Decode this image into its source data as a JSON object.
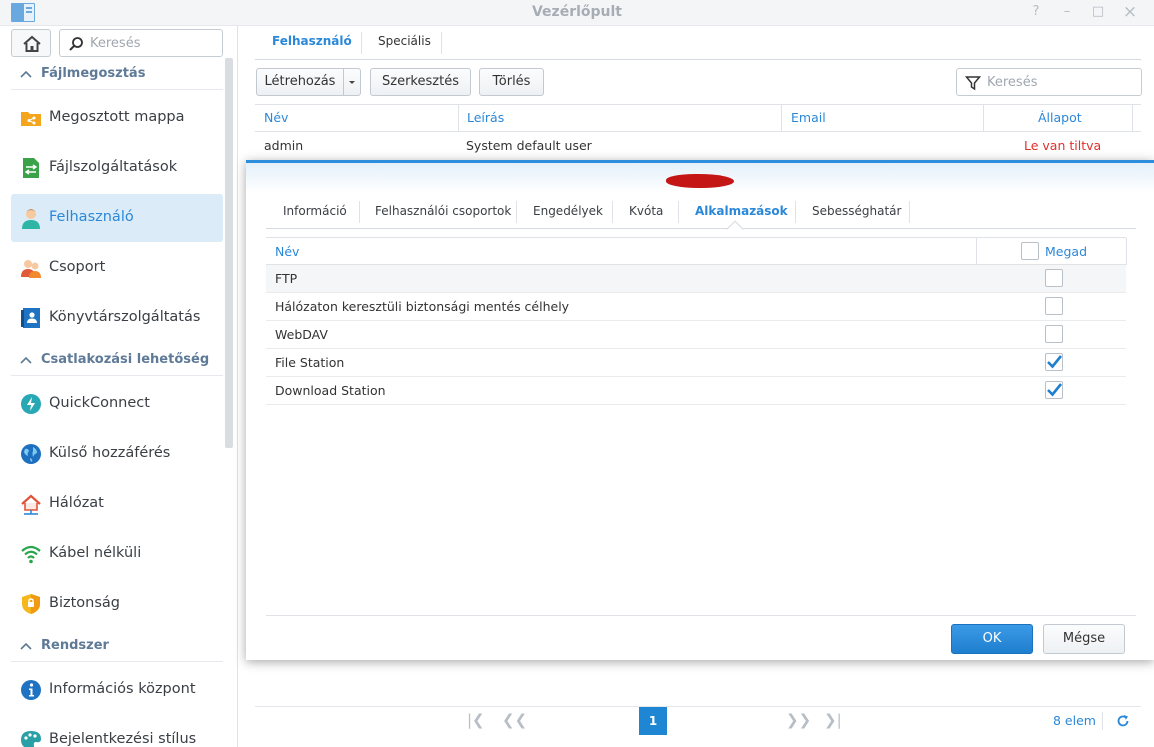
{
  "window": {
    "title": "Vezérlőpult",
    "controls": [
      "?",
      "–",
      "□",
      "×"
    ]
  },
  "sidebar": {
    "search_placeholder": "Keresés",
    "sections": [
      {
        "label": "Fájlmegosztás"
      },
      {
        "label": "Csatlakozási lehetőség"
      },
      {
        "label": "Rendszer"
      }
    ],
    "items": [
      {
        "label": "Megosztott mappa",
        "icon": "shared-folder-icon"
      },
      {
        "label": "Fájlszolgáltatások",
        "icon": "file-services-icon"
      },
      {
        "label": "Felhasználó",
        "icon": "user-icon",
        "active": true
      },
      {
        "label": "Csoport",
        "icon": "group-icon"
      },
      {
        "label": "Könyvtárszolgáltatás",
        "icon": "directory-icon"
      },
      {
        "label": "QuickConnect",
        "icon": "quickconnect-icon"
      },
      {
        "label": "Külső hozzáférés",
        "icon": "globe-icon"
      },
      {
        "label": "Hálózat",
        "icon": "network-icon"
      },
      {
        "label": "Kábel nélküli",
        "icon": "wifi-icon"
      },
      {
        "label": "Biztonság",
        "icon": "shield-icon"
      },
      {
        "label": "Információs központ",
        "icon": "info-icon"
      },
      {
        "label": "Bejelentkezési stílus",
        "icon": "palette-icon"
      }
    ]
  },
  "main": {
    "tabs": [
      {
        "label": "Felhasználó",
        "active": true
      },
      {
        "label": "Speciális"
      }
    ],
    "toolbar": {
      "create": "Létrehozás",
      "edit": "Szerkesztés",
      "delete": "Törlés",
      "search_placeholder": "Keresés"
    },
    "columns": {
      "name": "Név",
      "description": "Leírás",
      "email": "Email",
      "status": "Állapot"
    },
    "rows": [
      {
        "name": "admin",
        "description": "System default user",
        "email": "",
        "status": "Le van tiltva"
      }
    ],
    "pager": {
      "current_page": "1",
      "count": "8 elem"
    }
  },
  "dialog": {
    "tabs": [
      {
        "label": "Információ"
      },
      {
        "label": "Felhasználói csoportok"
      },
      {
        "label": "Engedélyek"
      },
      {
        "label": "Kvóta"
      },
      {
        "label": "Alkalmazások",
        "active": true
      },
      {
        "label": "Sebességhatár"
      }
    ],
    "columns": {
      "name": "Név",
      "allow": "Megad"
    },
    "apps": [
      {
        "name": "FTP",
        "allowed": false
      },
      {
        "name": "Hálózaton keresztüli biztonsági mentés célhely",
        "allowed": false
      },
      {
        "name": "WebDAV",
        "allowed": false
      },
      {
        "name": "File Station",
        "allowed": true
      },
      {
        "name": "Download Station",
        "allowed": true
      }
    ],
    "ok": "OK",
    "cancel": "Mégse"
  },
  "colors": {
    "accent": "#2b88d8",
    "status_disabled": "#e0302b",
    "redaction": "#c51616"
  }
}
